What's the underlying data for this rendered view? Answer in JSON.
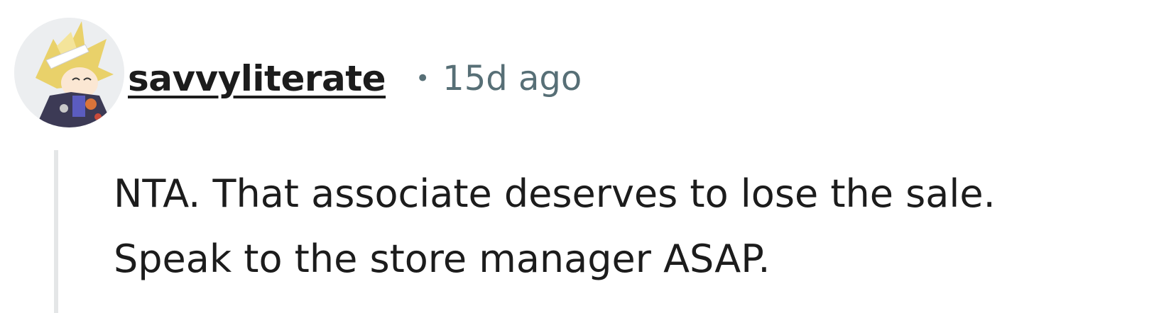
{
  "comment": {
    "username": "savvyliterate",
    "separator": "•",
    "timestamp": "15d ago",
    "avatar_icon": "user-avatar-icon",
    "body_lines": [
      "NTA. That associate deserves to lose the sale.",
      "Speak to the store manager ASAP."
    ]
  },
  "colors": {
    "text": "#1c1c1c",
    "meta": "#576f76",
    "thread_line": "#e4e6e7",
    "background": "#ffffff"
  }
}
